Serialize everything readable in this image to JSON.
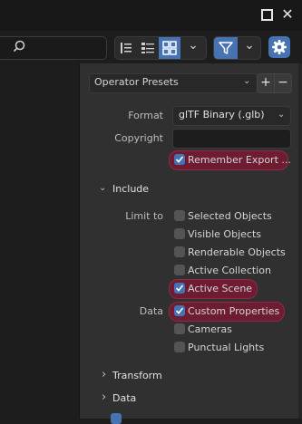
{
  "window": {
    "maximize_icon": "maximize-icon",
    "close_glyph": "✕"
  },
  "toolbar": {
    "search_placeholder": "",
    "view_chevron": "⌄",
    "filter_chevron": "⌄"
  },
  "presets": {
    "label": "Operator Presets",
    "chevron": "⌄",
    "add": "+",
    "remove": "−"
  },
  "fields": {
    "format_label": "Format",
    "format_value": "glTF Binary (.glb)",
    "format_chevron": "⌄",
    "copyright_label": "Copyright",
    "copyright_value": "",
    "remember_label": "Remember Export ..."
  },
  "include": {
    "title": "Include",
    "chevron": "⌄",
    "limit_label": "Limit to",
    "limit_items": [
      {
        "label": "Selected Objects",
        "checked": false
      },
      {
        "label": "Visible Objects",
        "checked": false
      },
      {
        "label": "Renderable Objects",
        "checked": false
      },
      {
        "label": "Active Collection",
        "checked": false
      },
      {
        "label": "Active Scene",
        "checked": true
      }
    ],
    "data_label": "Data",
    "data_items": [
      {
        "label": "Custom Properties",
        "checked": true
      },
      {
        "label": "Cameras",
        "checked": false
      },
      {
        "label": "Punctual Lights",
        "checked": false
      }
    ]
  },
  "sections": [
    {
      "title": "Transform",
      "chevron": "›"
    },
    {
      "title": "Data",
      "chevron": "›"
    }
  ],
  "colors": {
    "accent": "#4772b3",
    "highlight": "#7a1932",
    "panel": "#303030"
  }
}
